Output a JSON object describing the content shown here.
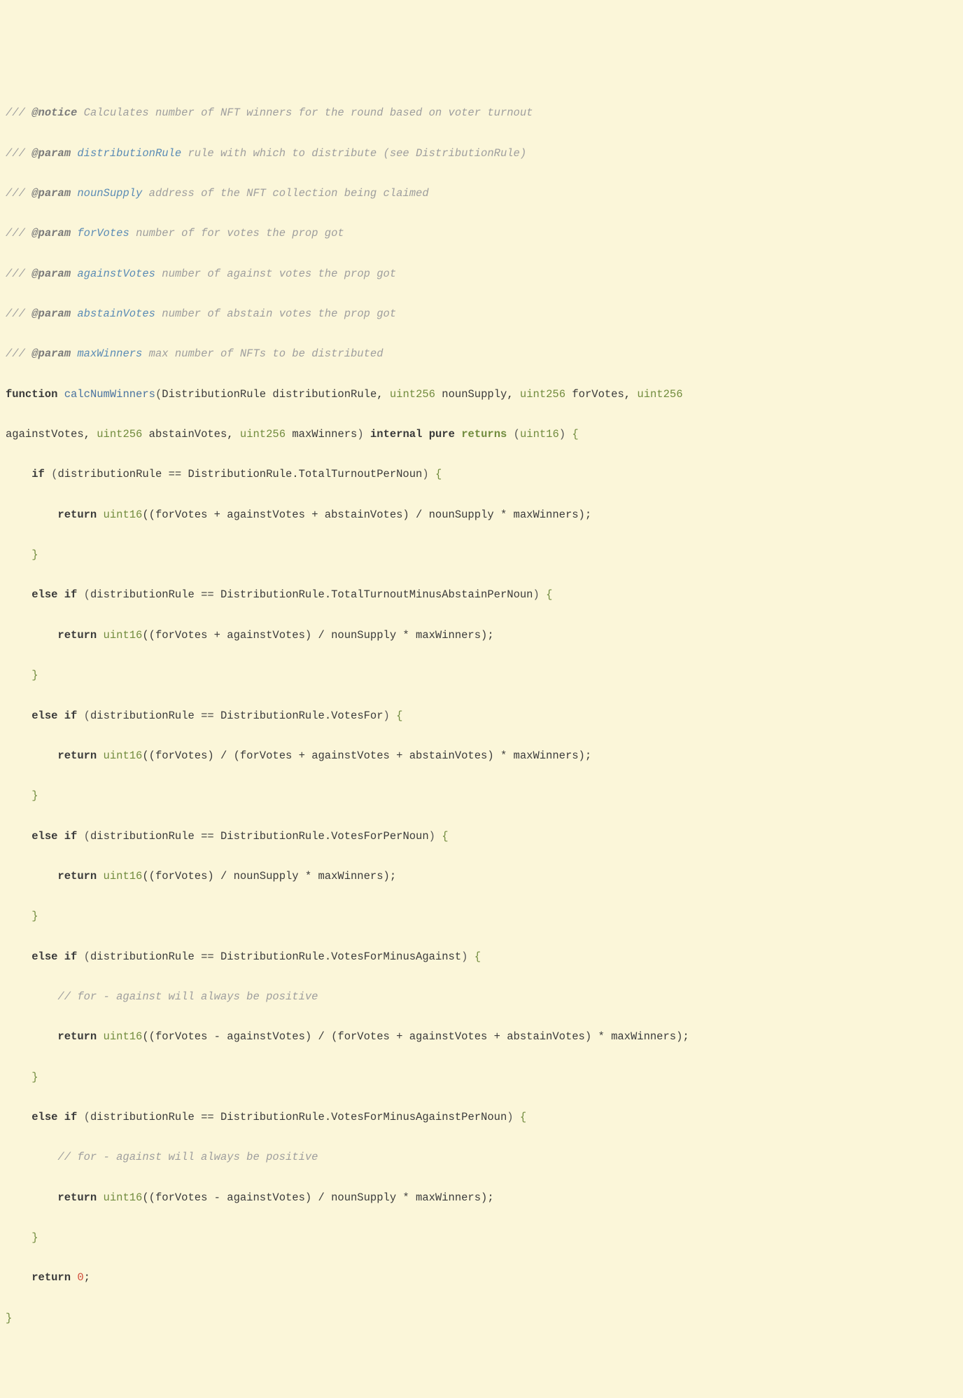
{
  "doc": {
    "notice_tag": "@notice",
    "notice_text": " Calculates number of NFT winners for the round based on voter turnout",
    "param_tag": "@param",
    "p1_name": "distributionRule",
    "p1_text": " rule with which to distribute (see DistributionRule)",
    "p2_name": "nounSupply",
    "p2_text": " address of the NFT collection being claimed",
    "p3_name": "forVotes",
    "p3_text": " number of for votes the prop got",
    "p4_name": "againstVotes",
    "p4_text": " number of against votes the prop got",
    "p5_name": "abstainVotes",
    "p5_text": " number of abstain votes the prop got",
    "p6_name": "maxWinners",
    "p6_text": " max number of NFTs to be distributed",
    "slash": "/// "
  },
  "kw": {
    "function": "function",
    "if": "if",
    "else_if": "else if",
    "return": "return",
    "internal_pure": "internal pure",
    "returns": "returns"
  },
  "sig": {
    "name": "calcNumWinners",
    "type_dist": "DistributionRule",
    "arg_dist": "distributionRule",
    "uint256": "uint256",
    "arg_noun": "nounSupply",
    "arg_for": "forVotes",
    "arg_against": "againstVotes",
    "arg_abstain": "abstainVotes",
    "arg_max": "maxWinners",
    "uint16": "uint16"
  },
  "body": {
    "cond_prefix": "distributionRule == DistributionRule.",
    "rule1": "TotalTurnoutPerNoun",
    "ret1": "((forVotes + againstVotes + abstainVotes) / nounSupply * maxWinners)",
    "rule2": "TotalTurnoutMinusAbstainPerNoun",
    "ret2": "((forVotes + againstVotes) / nounSupply * maxWinners)",
    "rule3": "VotesFor",
    "ret3": "((forVotes) / (forVotes + againstVotes + abstainVotes) * maxWinners)",
    "rule4": "VotesForPerNoun",
    "ret4": "((forVotes) / nounSupply * maxWinners)",
    "rule5": "VotesForMinusAgainst",
    "comment5": "// for - against will always be positive",
    "ret5": "((forVotes - againstVotes) / (forVotes + againstVotes + abstainVotes) * maxWinners)",
    "rule6": "VotesForMinusAgainstPerNoun",
    "comment6": "// for - against will always be positive",
    "ret6": "((forVotes - againstVotes) / nounSupply * maxWinners)",
    "return0": "0",
    "uint16_cast": "uint16"
  }
}
